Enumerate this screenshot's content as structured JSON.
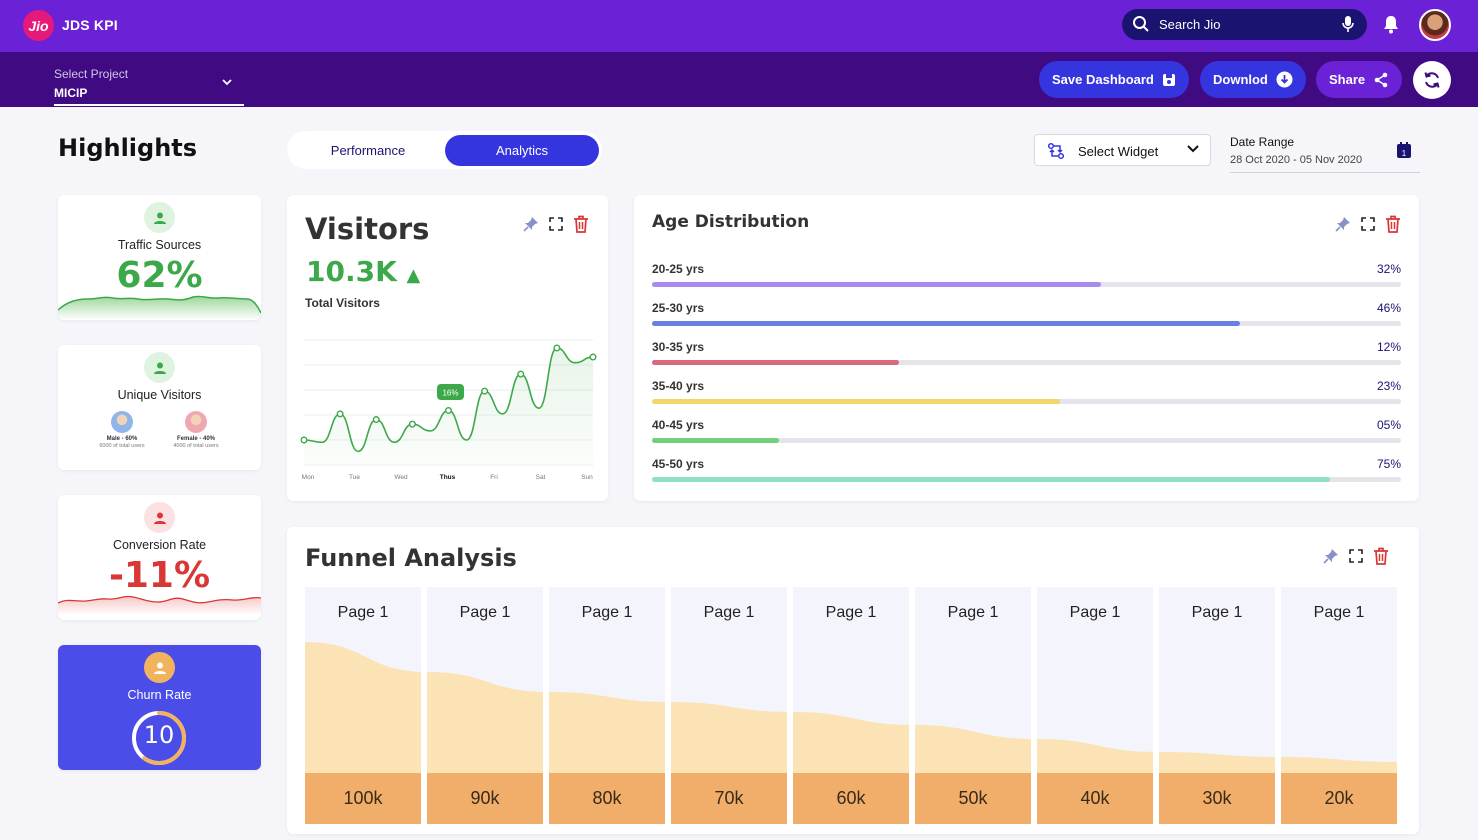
{
  "app": {
    "logo": "Jio",
    "title": "JDS KPI"
  },
  "search": {
    "placeholder": "Search Jio",
    "icon": "search-icon"
  },
  "project": {
    "label": "Select Project",
    "value": "MICIP"
  },
  "buttons": {
    "save": "Save Dashboard",
    "download": "Downlod",
    "share": "Share"
  },
  "highlights": {
    "title": "Highlights"
  },
  "tabs": [
    {
      "label": "Performance",
      "active": false
    },
    {
      "label": "Analytics",
      "active": true
    }
  ],
  "widget": {
    "label": "Select Widget"
  },
  "date_range": {
    "label": "Date Range",
    "value": "28 Oct 2020 - 05 Nov 2020"
  },
  "kpi_cards": {
    "traffic": {
      "label": "Traffic Sources",
      "value": "62%",
      "color": "#3da84a"
    },
    "unique": {
      "label": "Unique Visitors",
      "male": {
        "title": "Male - 60%",
        "sub": "6000 of total users"
      },
      "female": {
        "title": "Female - 40%",
        "sub": "4000 of total users"
      }
    },
    "conversion": {
      "label": "Conversion Rate",
      "value": "-11%",
      "color": "#d93636"
    },
    "churn": {
      "label": "Churn Rate",
      "value": "10",
      "gauge_fraction": 0.6
    }
  },
  "visitors": {
    "title": "Visitors",
    "value": "10.3K",
    "trend": "up",
    "subtitle": "Total Visitors",
    "tooltip": "16%",
    "days": [
      "Mon",
      "Tue",
      "Wed",
      "Thus",
      "Fri",
      "Sat",
      "Sun"
    ],
    "highlight_day": "Thus"
  },
  "chart_data": {
    "type": "line",
    "x": [
      "Mon",
      "Tue",
      "Wed",
      "Thus",
      "Fri",
      "Sat",
      "Sun"
    ],
    "series": [
      {
        "values": [
          22,
          20,
          45,
          12,
          40,
          20,
          36,
          30,
          48,
          22,
          65,
          45,
          80,
          50,
          103,
          90,
          95
        ]
      }
    ],
    "point_x": [
      0,
      0.5,
      1,
      1.5,
      2,
      2.5,
      3,
      3.5,
      4,
      4.5,
      5,
      5.5,
      6
    ]
  },
  "age_distribution": {
    "title": "Age Distribution",
    "rows": [
      {
        "label": "20-25 yrs",
        "pct": "32%",
        "fill": 0.6,
        "color": "#a98bef"
      },
      {
        "label": "25-30 yrs",
        "pct": "46%",
        "fill": 0.785,
        "color": "#6b7fe0"
      },
      {
        "label": "30-35 yrs",
        "pct": "12%",
        "fill": 0.33,
        "color": "#d76a7e"
      },
      {
        "label": "35-40 yrs",
        "pct": "23%",
        "fill": 0.545,
        "color": "#f2d66a"
      },
      {
        "label": "40-45 yrs",
        "pct": "05%",
        "fill": 0.17,
        "color": "#72d07a"
      },
      {
        "label": "45-50 yrs",
        "pct": "75%",
        "fill": 0.905,
        "color": "#8fe0c8"
      }
    ]
  },
  "funnel": {
    "title": "Funnel Analysis",
    "steps": [
      {
        "label": "Page 1",
        "value": "100k"
      },
      {
        "label": "Page 1",
        "value": "90k"
      },
      {
        "label": "Page 1",
        "value": "80k"
      },
      {
        "label": "Page 1",
        "value": "70k"
      },
      {
        "label": "Page 1",
        "value": "60k"
      },
      {
        "label": "Page 1",
        "value": "50k"
      },
      {
        "label": "Page 1",
        "value": "40k"
      },
      {
        "label": "Page 1",
        "value": "30k"
      },
      {
        "label": "Page 1",
        "value": "20k"
      }
    ]
  },
  "colors": {
    "topbar": "#6b21d6",
    "subbar": "#3f0a82",
    "primary": "#3535e0",
    "funnel_fill": "#fbe3b6",
    "funnel_value": "#f1ae6a"
  }
}
